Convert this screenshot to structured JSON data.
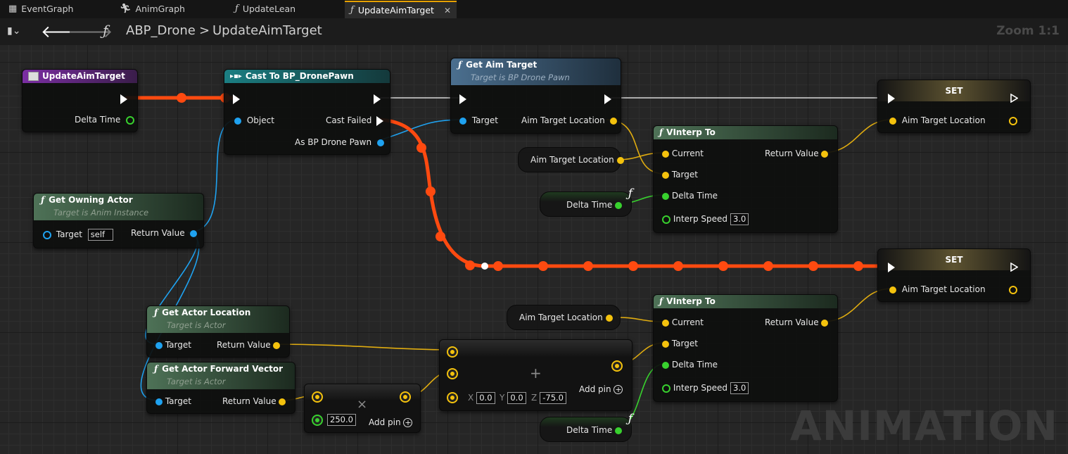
{
  "tabs": [
    {
      "label": "EventGraph",
      "icon": "graph-icon"
    },
    {
      "label": "AnimGraph",
      "icon": "running-man-icon"
    },
    {
      "label": "UpdateLean",
      "icon": "function-icon"
    },
    {
      "label": "UpdateAimTarget",
      "icon": "function-icon",
      "active": true
    }
  ],
  "toolbar": {
    "breadcrumb_root": "ABP_Drone",
    "breadcrumb_sep": ">",
    "breadcrumb_leaf": "UpdateAimTarget",
    "zoom": "Zoom 1:1"
  },
  "nodes": {
    "entry": {
      "title": "UpdateAimTarget",
      "pin_delta": "Delta Time"
    },
    "cast": {
      "title": "Cast To BP_DronePawn",
      "pin_object": "Object",
      "pin_failed": "Cast Failed",
      "pin_as": "As BP Drone Pawn"
    },
    "get_aim": {
      "title": "Get Aim Target",
      "subtitle": "Target is BP Drone Pawn",
      "pin_target": "Target",
      "pin_out": "Aim Target Location"
    },
    "set1": {
      "title": "SET",
      "pin": "Aim Target Location"
    },
    "set2": {
      "title": "SET",
      "pin": "Aim Target Location"
    },
    "owning": {
      "title": "Get Owning Actor",
      "subtitle": "Target is Anim Instance",
      "pin_target": "Target",
      "target_value": "self",
      "pin_out": "Return Value"
    },
    "vinterp1": {
      "title": "VInterp To",
      "current": "Current",
      "target": "Target",
      "delta": "Delta Time",
      "speed": "Interp Speed",
      "speed_value": "3.0",
      "out": "Return Value"
    },
    "vinterp2": {
      "title": "VInterp To",
      "current": "Current",
      "target": "Target",
      "delta": "Delta Time",
      "speed": "Interp Speed",
      "speed_value": "3.0",
      "out": "Return Value"
    },
    "aimloc1": {
      "label": "Aim Target Location"
    },
    "aimloc2": {
      "label": "Aim Target Location"
    },
    "dt1": {
      "label": "Delta Time"
    },
    "dt2": {
      "label": "Delta Time"
    },
    "actorloc": {
      "title": "Get Actor Location",
      "subtitle": "Target is Actor",
      "pin_target": "Target",
      "pin_out": "Return Value"
    },
    "fwd": {
      "title": "Get Actor Forward Vector",
      "subtitle": "Target is Actor",
      "pin_target": "Target",
      "pin_out": "Return Value"
    },
    "mult": {
      "symbol": "×",
      "value": "250.0",
      "add_pin": "Add pin"
    },
    "add": {
      "symbol": "+",
      "x_label": "X",
      "x": "0.0",
      "y_label": "Y",
      "y": "0.0",
      "z_label": "Z",
      "z": "-75.0",
      "add_pin": "Add pin"
    }
  },
  "watermark": "ANIMATION",
  "colors": {
    "exec_wire": "#ff4a10",
    "vector_pin": "#f4c20d",
    "object_pin": "#1fa2f0",
    "float_pin": "#38d12e",
    "function_header": "#355c3c",
    "cast_header": "#1d6a6e",
    "entry_header": "#6b2c8e"
  }
}
